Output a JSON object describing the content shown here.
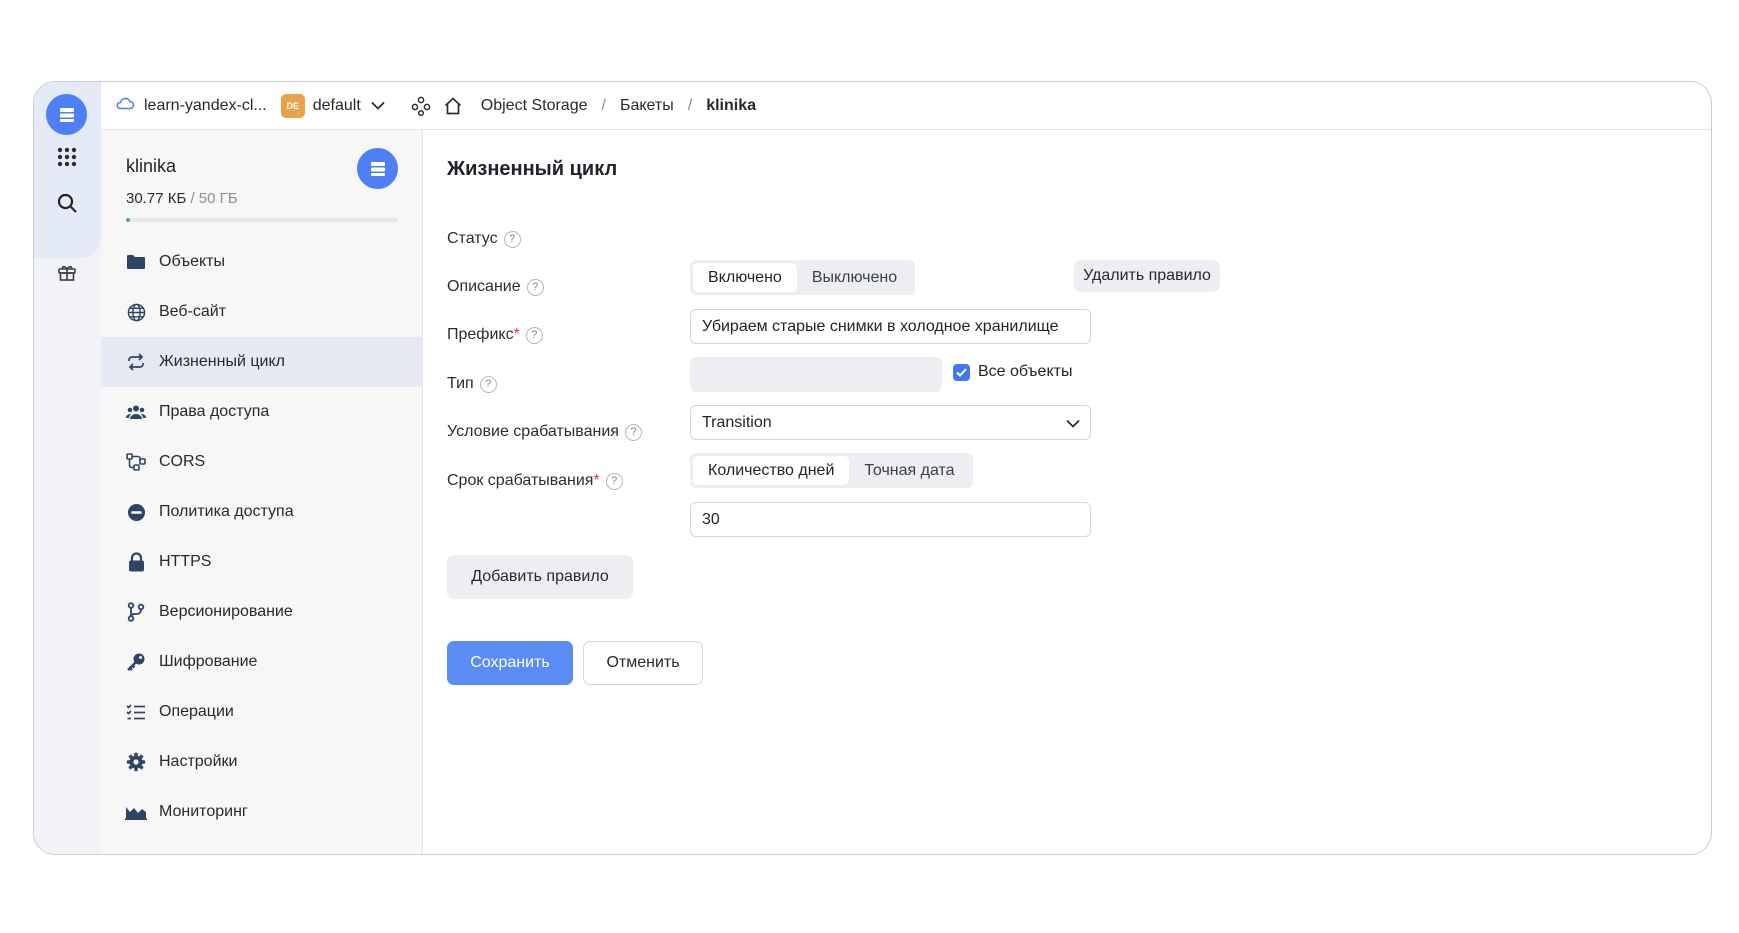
{
  "header": {
    "cloud_name": "learn-yandex-cl...",
    "folder_badge": "DE",
    "folder_name": "default",
    "breadcrumbs": [
      "Object Storage",
      "Бакеты",
      "klinika"
    ],
    "separator": "/"
  },
  "bucket": {
    "name": "klinika",
    "used": "30.77 КБ",
    "limit": "/ 50 ГБ",
    "usage_fraction": 0.01
  },
  "sidebar": {
    "items": [
      {
        "label": "Объекты",
        "icon": "folder-icon"
      },
      {
        "label": "Веб-сайт",
        "icon": "globe-icon"
      },
      {
        "label": "Жизненный цикл",
        "icon": "cycle-icon",
        "active": true
      },
      {
        "label": "Права доступа",
        "icon": "users-icon"
      },
      {
        "label": "CORS",
        "icon": "cors-icon"
      },
      {
        "label": "Политика доступа",
        "icon": "minus-circle-icon"
      },
      {
        "label": "HTTPS",
        "icon": "lock-icon"
      },
      {
        "label": "Версионирование",
        "icon": "branch-icon"
      },
      {
        "label": "Шифрование",
        "icon": "key-icon"
      },
      {
        "label": "Операции",
        "icon": "list-check-icon"
      },
      {
        "label": "Настройки",
        "icon": "gear-icon"
      },
      {
        "label": "Мониторинг",
        "icon": "chart-icon"
      }
    ]
  },
  "form": {
    "title": "Жизненный цикл",
    "status": {
      "label": "Статус",
      "options": [
        "Включено",
        "Выключено"
      ],
      "selected": "Включено"
    },
    "delete_rule": "Удалить правило",
    "description": {
      "label": "Описание",
      "value": "Убираем старые снимки в холодное хранилище"
    },
    "prefix": {
      "label": "Префикс",
      "required_mark": "*",
      "value": "",
      "all_objects_label": "Все объекты",
      "all_objects_checked": true
    },
    "type": {
      "label": "Тип",
      "value": "Transition"
    },
    "condition": {
      "label": "Условие срабатывания",
      "options": [
        "Количество дней",
        "Точная дата"
      ],
      "selected": "Количество дней"
    },
    "term": {
      "label": "Срок срабатывания",
      "required_mark": "*",
      "value": "30"
    },
    "help_glyph": "?",
    "add_rule": "Добавить правило",
    "save": "Сохранить",
    "cancel": "Отменить"
  },
  "colors": {
    "accent": "#5b8cf4",
    "active_nav": "#e4e9f4",
    "required": "#e5383b",
    "usage": "#4cb85c"
  }
}
